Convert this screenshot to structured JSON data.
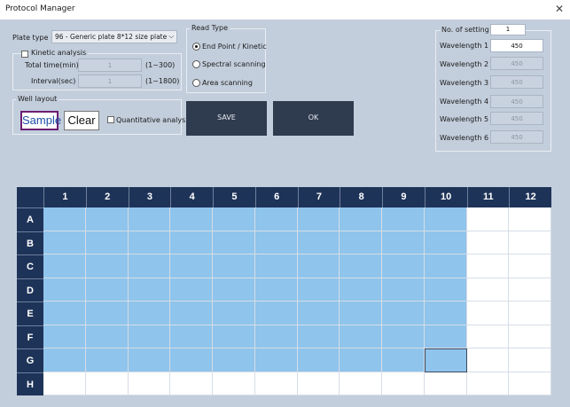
{
  "window": {
    "title": "Protocol Manager",
    "close_glyph": "✕"
  },
  "plate_type": {
    "label": "Plate type :",
    "value": "96 - Generic plate 8*12  size plate",
    "arrow": "⌵"
  },
  "kinetic": {
    "label": "Kinetic analysis",
    "total_time_label": "Total time(min)",
    "total_time_value": "1",
    "total_time_range": "(1~300)",
    "interval_label": "Interval(sec)",
    "interval_value": "1",
    "interval_range": "(1~1800)"
  },
  "read_type": {
    "legend": "Read Type",
    "options": [
      "End Point / Kinetic",
      "Spectral scanning",
      "Area scanning"
    ],
    "selected": "End Point / Kinetic"
  },
  "well_layout": {
    "legend": "Well layout",
    "sample_label": "Sample",
    "clear_label": "Clear",
    "quant_label": "Quantitative analysis"
  },
  "buttons": {
    "save_label": "SAVE",
    "ok_label": "OK"
  },
  "settings": {
    "legend": "No. of setting",
    "count": "1",
    "wavelengths": [
      {
        "label": "Wavelength 1 :",
        "value": "450"
      },
      {
        "label": "Wavelength 2 :",
        "value": "450"
      },
      {
        "label": "Wavelength 3 :",
        "value": "450"
      },
      {
        "label": "Wavelength 4 :",
        "value": "450"
      },
      {
        "label": "Wavelength 5 :",
        "value": "450"
      },
      {
        "label": "Wavelength 6 :",
        "value": "450"
      }
    ]
  },
  "plate": {
    "columns": [
      "1",
      "2",
      "3",
      "4",
      "5",
      "6",
      "7",
      "8",
      "9",
      "10",
      "11",
      "12"
    ],
    "rows": [
      "A",
      "B",
      "C",
      "D",
      "E",
      "F",
      "G",
      "H"
    ],
    "selected_rows": [
      "A",
      "B",
      "C",
      "D",
      "E",
      "F",
      "G"
    ],
    "selected_cols": [
      "1",
      "2",
      "3",
      "4",
      "5",
      "6",
      "7",
      "8",
      "9",
      "10"
    ],
    "focused_cell": "G10",
    "colors": {
      "selected": "#8fc4ec",
      "header": "#1e3358",
      "empty": "#ffffff"
    }
  }
}
